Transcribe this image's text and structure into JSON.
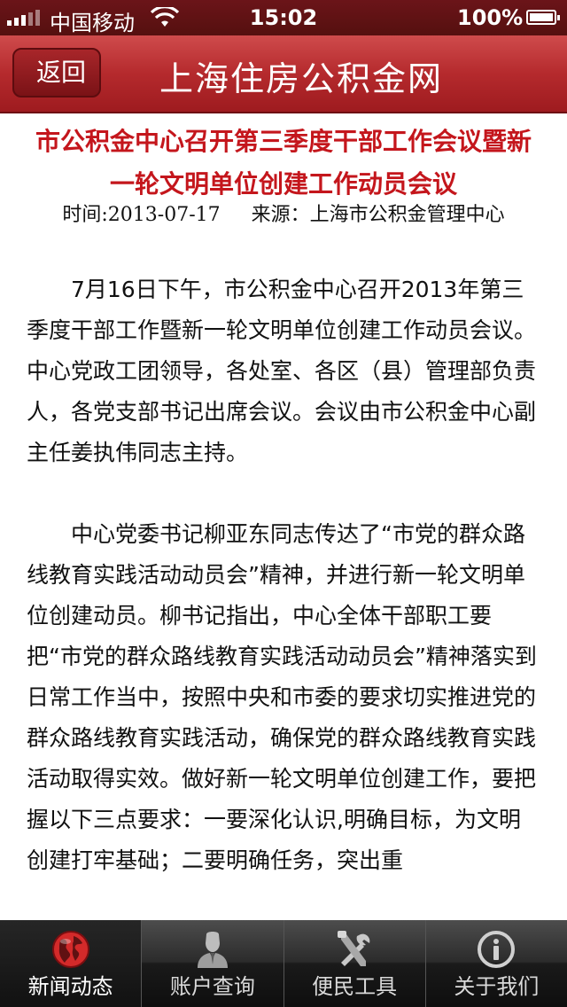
{
  "status_bar": {
    "carrier": "中国移动",
    "time": "15:02",
    "battery_percent": "100%",
    "signal_bars": 5,
    "signal_bars_active": 3
  },
  "nav": {
    "back_label": "返回",
    "title": "上海住房公积金网"
  },
  "article": {
    "title": "市公积金中心召开第三季度干部工作会议暨新一轮文明单位创建工作动员会议",
    "date": "时间:2013-07-17",
    "source": "来源：上海市公积金管理中心",
    "paragraphs": [
      "7月16日下午，市公积金中心召开2013年第三季度干部工作暨新一轮文明单位创建工作动员会议。中心党政工团领导，各处室、各区（县）管理部负责人，各党支部书记出席会议。会议由市公积金中心副主任姜执伟同志主持。",
      "中心党委书记柳亚东同志传达了“市党的群众路线教育实践活动动员会”精神，并进行新一轮文明单位创建动员。柳书记指出，中心全体干部职工要把“市党的群众路线教育实践活动动员会”精神落实到日常工作当中，按照中央和市委的要求切实推进党的群众路线教育实践活动，确保党的群众路线教育实践活动取得实效。做好新一轮文明单位创建工作，要把握以下三点要求：一要深化认识,明确目标，为文明创建打牢基础；二要明确任务，突出重"
    ]
  },
  "tabs": [
    {
      "label": "新闻动态",
      "icon": "globe-icon",
      "active": true
    },
    {
      "label": "账户查询",
      "icon": "user-icon",
      "active": false
    },
    {
      "label": "便民工具",
      "icon": "tools-icon",
      "active": false
    },
    {
      "label": "关于我们",
      "icon": "info-icon",
      "active": false
    }
  ],
  "colors": {
    "nav_red": "#b52a2d",
    "title_red": "#c4161c",
    "status_bar": "#5e1214",
    "tab_bar": "#2b2b2b",
    "globe_red": "#d32a2a"
  }
}
